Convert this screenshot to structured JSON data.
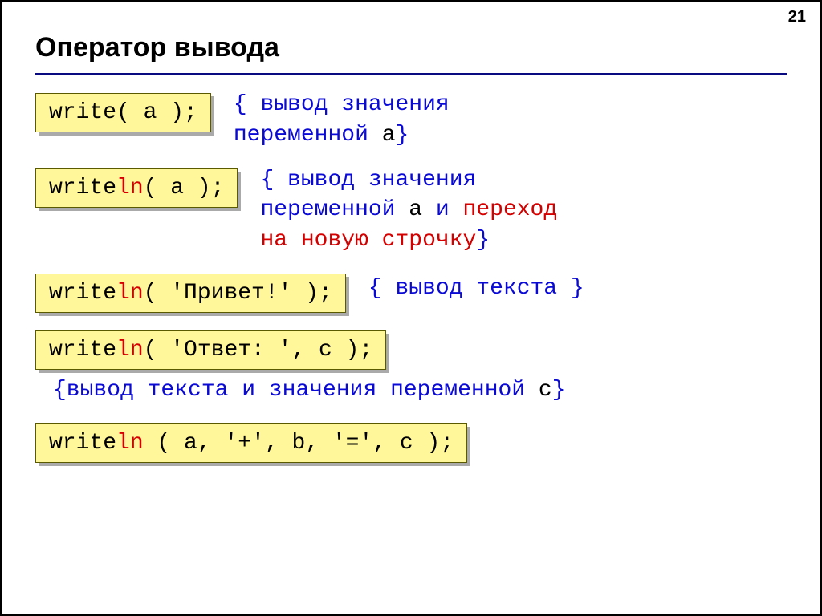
{
  "page_number": "21",
  "title": "Оператор вывода",
  "rows": [
    {
      "code_pre": "write( a );",
      "comment_l1": "{ вывод значения",
      "comment_l2_pre": "переменной ",
      "comment_l2_var": "a",
      "comment_l2_post": "}"
    },
    {
      "code_write": "write",
      "code_ln": "ln",
      "code_post": "( a );",
      "comment_l1": "{ вывод значения",
      "comment_l2_pre": "переменной ",
      "comment_l2_var": "a",
      "comment_l2_post": " и ",
      "comment_l3_red": "переход",
      "comment_l4_red": "на новую строчку",
      "comment_l4_post": "}"
    },
    {
      "code_write": "write",
      "code_ln": "ln",
      "code_post": "( 'Привет!' );",
      "comment": "{ вывод текста }"
    },
    {
      "code_write": "write",
      "code_ln": "ln",
      "code_post": "( 'Ответ: ', c );"
    }
  ],
  "standalone_comment_pre": "{вывод текста и значения переменной ",
  "standalone_comment_var": "c",
  "standalone_comment_post": "}",
  "last_code_write": "write",
  "last_code_ln": "ln",
  "last_code_post": " ( a, '+', b, '=', c );"
}
